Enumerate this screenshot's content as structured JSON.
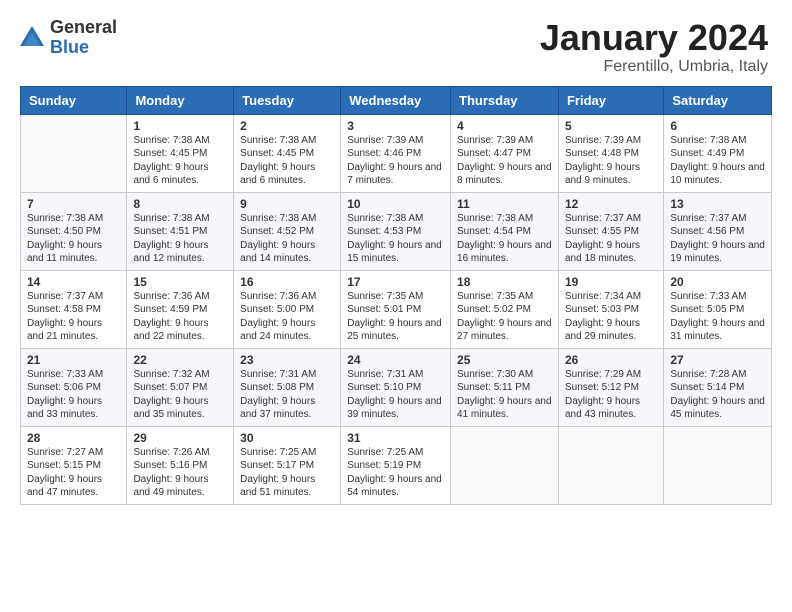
{
  "logo": {
    "general": "General",
    "blue": "Blue"
  },
  "header": {
    "month": "January 2024",
    "location": "Ferentillo, Umbria, Italy"
  },
  "weekdays": [
    "Sunday",
    "Monday",
    "Tuesday",
    "Wednesday",
    "Thursday",
    "Friday",
    "Saturday"
  ],
  "weeks": [
    [
      {
        "day": "",
        "sunrise": "",
        "sunset": "",
        "daylight": ""
      },
      {
        "day": "1",
        "sunrise": "Sunrise: 7:38 AM",
        "sunset": "Sunset: 4:45 PM",
        "daylight": "Daylight: 9 hours and 6 minutes."
      },
      {
        "day": "2",
        "sunrise": "Sunrise: 7:38 AM",
        "sunset": "Sunset: 4:45 PM",
        "daylight": "Daylight: 9 hours and 6 minutes."
      },
      {
        "day": "3",
        "sunrise": "Sunrise: 7:39 AM",
        "sunset": "Sunset: 4:46 PM",
        "daylight": "Daylight: 9 hours and 7 minutes."
      },
      {
        "day": "4",
        "sunrise": "Sunrise: 7:39 AM",
        "sunset": "Sunset: 4:47 PM",
        "daylight": "Daylight: 9 hours and 8 minutes."
      },
      {
        "day": "5",
        "sunrise": "Sunrise: 7:39 AM",
        "sunset": "Sunset: 4:48 PM",
        "daylight": "Daylight: 9 hours and 9 minutes."
      },
      {
        "day": "6",
        "sunrise": "Sunrise: 7:38 AM",
        "sunset": "Sunset: 4:49 PM",
        "daylight": "Daylight: 9 hours and 10 minutes."
      }
    ],
    [
      {
        "day": "7",
        "sunrise": "Sunrise: 7:38 AM",
        "sunset": "Sunset: 4:50 PM",
        "daylight": "Daylight: 9 hours and 11 minutes."
      },
      {
        "day": "8",
        "sunrise": "Sunrise: 7:38 AM",
        "sunset": "Sunset: 4:51 PM",
        "daylight": "Daylight: 9 hours and 12 minutes."
      },
      {
        "day": "9",
        "sunrise": "Sunrise: 7:38 AM",
        "sunset": "Sunset: 4:52 PM",
        "daylight": "Daylight: 9 hours and 14 minutes."
      },
      {
        "day": "10",
        "sunrise": "Sunrise: 7:38 AM",
        "sunset": "Sunset: 4:53 PM",
        "daylight": "Daylight: 9 hours and 15 minutes."
      },
      {
        "day": "11",
        "sunrise": "Sunrise: 7:38 AM",
        "sunset": "Sunset: 4:54 PM",
        "daylight": "Daylight: 9 hours and 16 minutes."
      },
      {
        "day": "12",
        "sunrise": "Sunrise: 7:37 AM",
        "sunset": "Sunset: 4:55 PM",
        "daylight": "Daylight: 9 hours and 18 minutes."
      },
      {
        "day": "13",
        "sunrise": "Sunrise: 7:37 AM",
        "sunset": "Sunset: 4:56 PM",
        "daylight": "Daylight: 9 hours and 19 minutes."
      }
    ],
    [
      {
        "day": "14",
        "sunrise": "Sunrise: 7:37 AM",
        "sunset": "Sunset: 4:58 PM",
        "daylight": "Daylight: 9 hours and 21 minutes."
      },
      {
        "day": "15",
        "sunrise": "Sunrise: 7:36 AM",
        "sunset": "Sunset: 4:59 PM",
        "daylight": "Daylight: 9 hours and 22 minutes."
      },
      {
        "day": "16",
        "sunrise": "Sunrise: 7:36 AM",
        "sunset": "Sunset: 5:00 PM",
        "daylight": "Daylight: 9 hours and 24 minutes."
      },
      {
        "day": "17",
        "sunrise": "Sunrise: 7:35 AM",
        "sunset": "Sunset: 5:01 PM",
        "daylight": "Daylight: 9 hours and 25 minutes."
      },
      {
        "day": "18",
        "sunrise": "Sunrise: 7:35 AM",
        "sunset": "Sunset: 5:02 PM",
        "daylight": "Daylight: 9 hours and 27 minutes."
      },
      {
        "day": "19",
        "sunrise": "Sunrise: 7:34 AM",
        "sunset": "Sunset: 5:03 PM",
        "daylight": "Daylight: 9 hours and 29 minutes."
      },
      {
        "day": "20",
        "sunrise": "Sunrise: 7:33 AM",
        "sunset": "Sunset: 5:05 PM",
        "daylight": "Daylight: 9 hours and 31 minutes."
      }
    ],
    [
      {
        "day": "21",
        "sunrise": "Sunrise: 7:33 AM",
        "sunset": "Sunset: 5:06 PM",
        "daylight": "Daylight: 9 hours and 33 minutes."
      },
      {
        "day": "22",
        "sunrise": "Sunrise: 7:32 AM",
        "sunset": "Sunset: 5:07 PM",
        "daylight": "Daylight: 9 hours and 35 minutes."
      },
      {
        "day": "23",
        "sunrise": "Sunrise: 7:31 AM",
        "sunset": "Sunset: 5:08 PM",
        "daylight": "Daylight: 9 hours and 37 minutes."
      },
      {
        "day": "24",
        "sunrise": "Sunrise: 7:31 AM",
        "sunset": "Sunset: 5:10 PM",
        "daylight": "Daylight: 9 hours and 39 minutes."
      },
      {
        "day": "25",
        "sunrise": "Sunrise: 7:30 AM",
        "sunset": "Sunset: 5:11 PM",
        "daylight": "Daylight: 9 hours and 41 minutes."
      },
      {
        "day": "26",
        "sunrise": "Sunrise: 7:29 AM",
        "sunset": "Sunset: 5:12 PM",
        "daylight": "Daylight: 9 hours and 43 minutes."
      },
      {
        "day": "27",
        "sunrise": "Sunrise: 7:28 AM",
        "sunset": "Sunset: 5:14 PM",
        "daylight": "Daylight: 9 hours and 45 minutes."
      }
    ],
    [
      {
        "day": "28",
        "sunrise": "Sunrise: 7:27 AM",
        "sunset": "Sunset: 5:15 PM",
        "daylight": "Daylight: 9 hours and 47 minutes."
      },
      {
        "day": "29",
        "sunrise": "Sunrise: 7:26 AM",
        "sunset": "Sunset: 5:16 PM",
        "daylight": "Daylight: 9 hours and 49 minutes."
      },
      {
        "day": "30",
        "sunrise": "Sunrise: 7:25 AM",
        "sunset": "Sunset: 5:17 PM",
        "daylight": "Daylight: 9 hours and 51 minutes."
      },
      {
        "day": "31",
        "sunrise": "Sunrise: 7:25 AM",
        "sunset": "Sunset: 5:19 PM",
        "daylight": "Daylight: 9 hours and 54 minutes."
      },
      {
        "day": "",
        "sunrise": "",
        "sunset": "",
        "daylight": ""
      },
      {
        "day": "",
        "sunrise": "",
        "sunset": "",
        "daylight": ""
      },
      {
        "day": "",
        "sunrise": "",
        "sunset": "",
        "daylight": ""
      }
    ]
  ]
}
